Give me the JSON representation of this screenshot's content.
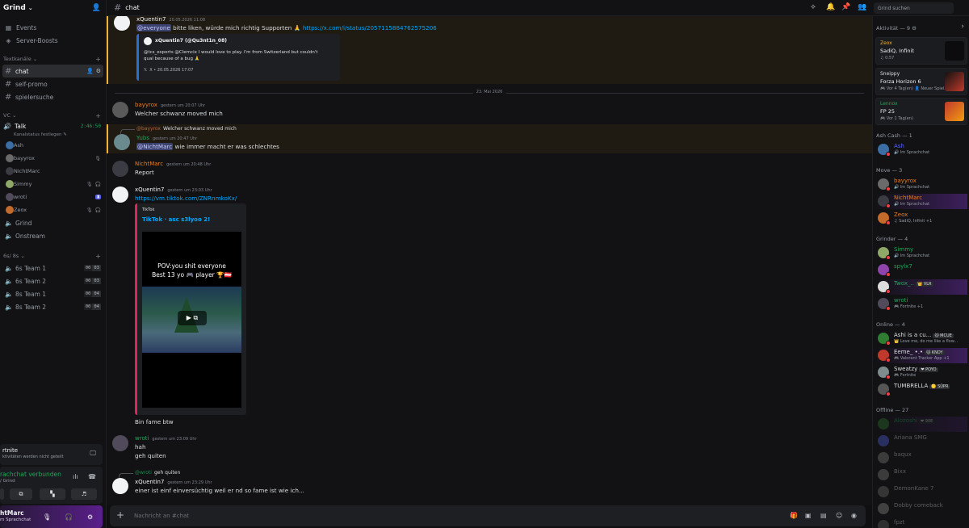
{
  "server": {
    "name": "Grind"
  },
  "sidebar_top": [
    {
      "label": "Events",
      "icon": "calendar-icon"
    },
    {
      "label": "Server-Boosts",
      "icon": "boost-icon"
    }
  ],
  "categories": {
    "text": "Textkanäle",
    "vc": "VC",
    "teams": "6s/ 8s"
  },
  "text_channels": [
    {
      "name": "chat",
      "active": true
    },
    {
      "name": "self-promo"
    },
    {
      "name": "spielersuche"
    }
  ],
  "voice": {
    "channel": "Talk",
    "timer": "2:46:50",
    "status": "Kanalstatus festlegen",
    "users": [
      {
        "name": "Ash",
        "color": "#3a6ea5"
      },
      {
        "name": "bayyrox",
        "color": "#6a6a6a"
      },
      {
        "name": "NichtMarc",
        "color": "#3b3b44"
      },
      {
        "name": "Simmy",
        "color": "#8fa868"
      },
      {
        "name": "wroti",
        "color": "#514a5a"
      },
      {
        "name": "Zeox",
        "color": "#c46a2a"
      }
    ]
  },
  "other_voice": [
    {
      "name": "Grind"
    },
    {
      "name": "Onstream"
    }
  ],
  "team_channels": [
    {
      "name": "6s Team 1",
      "a": "00",
      "b": "03"
    },
    {
      "name": "6s Team 2",
      "a": "00",
      "b": "03"
    },
    {
      "name": "8s Team 1",
      "a": "00",
      "b": "04"
    },
    {
      "name": "8s Team 2",
      "a": "00",
      "b": "04"
    }
  ],
  "activity_panel": {
    "title": "rtnite",
    "sub": "ktivitäten werden nicht geteilt"
  },
  "voice_panel": {
    "title": "rachchat verbunden",
    "sub": "/ Grind"
  },
  "user_panel": {
    "name": "htMarc",
    "status": "m Sprachchat"
  },
  "header": {
    "channel": "chat",
    "search_placeholder": "Grind suchen"
  },
  "messages": {
    "m1": {
      "author": "xQuentin7",
      "time": "20.05.2026 11:08",
      "mention": "@everyone",
      "text": " bitte liken, würde mich richtig Supporten 🙏 ",
      "link": "https://x.com/i/status/2057115884762575206",
      "embed": {
        "author": "xQuentin7 (@Qu3nt1n_08)",
        "line1": "@tcs_esports @Clemcix I would love to play. I'm from Switzerland but couldn't",
        "line2": "qual because of a bug 🙏",
        "footer": "X • 20.05.2026 17:07"
      }
    },
    "divider": "23. Mai 2026",
    "m2": {
      "author": "bayyrox",
      "time": "gestern um 20:07 Uhr",
      "text": "Welcher schwanz moved mich"
    },
    "m3": {
      "reply_name": "@bayyrox",
      "reply_text": "Welcher schwanz moved mich",
      "author": "Yubs",
      "time": "gestern um 20:47 Uhr",
      "mention": "@NichtMarc",
      "text": " wie immer macht er was schlechtes"
    },
    "m4": {
      "author": "NichtMarc",
      "time": "gestern um 20:48 Uhr",
      "text": "Report"
    },
    "m5": {
      "author": "xQuentin7",
      "time": "gestern um 23:03 Uhr",
      "link": "https://vm.tiktok.com/ZNRnmkoKx/",
      "embed": {
        "provider": "TikTok",
        "title": "TikTok · asc s3lyoo 2!",
        "video_line1": "POV:you shit everyone",
        "video_line2": "Best 13 yo 🎮 player 🏆🇦🇹"
      },
      "after": "Bin fame btw"
    },
    "m6": {
      "author": "wroti",
      "time": "gestern um 23:09 Uhr",
      "line1": "hah",
      "line2": "geh quiten"
    },
    "m7": {
      "reply_name": "@wroti",
      "reply_text": "geh quiten",
      "author": "xQuentin7",
      "time": "gestern um 23:29 Uhr",
      "text": "einer ist einf einversüchtig weil er nd so fame ist wie ich..."
    }
  },
  "composer": {
    "placeholder": "Nachricht an #chat"
  },
  "members": {
    "activity_header": "Aktivität — 9 ⚙",
    "cards": [
      {
        "name": "Zeox",
        "game": "SadiQ, Infinit",
        "sub": "♫ 0:57",
        "name_color": "#f0b232"
      },
      {
        "name": "Sneippy",
        "game": "Forza Horizon 6",
        "sub": "🎮 Vor 4 Tag(en)   👤 Neuer Spiel...",
        "name_color": "#dbdee1"
      },
      {
        "name": "Lennox",
        "game": "FP 25",
        "sub": "🎮 Vor 1 Tag(en)",
        "name_color": "#23a55a"
      }
    ],
    "groups": [
      {
        "title": "Ash Cash — 1",
        "items": [
          {
            "name": "Ash",
            "sub": "🔊 Im Sprachchat",
            "color": "#5865f2",
            "av": "#3a6ea5"
          }
        ]
      },
      {
        "title": "Move — 3",
        "items": [
          {
            "name": "bayyrox",
            "sub": "🔊 Im Sprachchat",
            "color": "#e67e22",
            "av": "#6a6a6a"
          },
          {
            "name": "NichtMarc",
            "sub": "🔊 Im Sprachchat",
            "color": "#e67e22",
            "av": "#3b3b44",
            "bg": true
          },
          {
            "name": "Zeox",
            "sub": "♫ SadiQ, Infinit +1",
            "color": "#e67e22",
            "av": "#c46a2a"
          }
        ]
      },
      {
        "title": "Grinder — 4",
        "items": [
          {
            "name": "Simmy",
            "sub": "🔊 Im Sprachchat",
            "color": "#23a55a",
            "av": "#8fa868"
          },
          {
            "name": "spylx7",
            "sub": "",
            "color": "#23a55a",
            "av": "#8e44ad"
          },
          {
            "name": "Twox_..",
            "sub": "",
            "tag": "👑 VLR",
            "color": "#23a55a",
            "av": "#dddddd",
            "bg": true
          },
          {
            "name": "wroti",
            "sub": "🎮 Fortnite +1",
            "color": "#23a55a",
            "av": "#514a5a"
          }
        ]
      },
      {
        "title": "Online — 4",
        "items": [
          {
            "name": "Ashi is a cu...",
            "sub": "👑 Love me, do me like a flow...",
            "tag": "🐱 MCUE",
            "color": "#dbdee1",
            "av": "#2e7d32"
          },
          {
            "name": "Eeme_ •.•",
            "sub": "🎮 Valorant Tracker App +1",
            "tag": "🐱 KNDY",
            "color": "#dbdee1",
            "av": "#c0392b",
            "bg": true
          },
          {
            "name": "Sweatzy",
            "sub": "🎮 Fortnite",
            "tag": "❤ POYO",
            "color": "#dbdee1",
            "av": "#7f8c8d"
          },
          {
            "name": "TUMBRELLA",
            "sub": "",
            "tag": "🟡 SÜPR",
            "color": "#dbdee1",
            "av": "#555555"
          }
        ]
      },
      {
        "title": "Offline — 27",
        "offline": true,
        "items": [
          {
            "name": "Alozoshi",
            "tag": "❤ 90E",
            "color": "#23a55a",
            "av": "#2e7d32",
            "bg": true
          },
          {
            "name": "Ariana SMG",
            "color": "#dbdee1",
            "av": "#5865f2"
          },
          {
            "name": "baqux",
            "color": "#dbdee1",
            "av": "#888888"
          },
          {
            "name": "Bixx",
            "color": "#dbdee1",
            "av": "#888888"
          },
          {
            "name": "DemonKane 7",
            "color": "#dbdee1",
            "av": "#777777"
          },
          {
            "name": "Dobby comeback",
            "color": "#dbdee1",
            "av": "#999999"
          },
          {
            "name": "fpzt",
            "color": "#dbdee1",
            "av": "#666666"
          }
        ]
      }
    ]
  }
}
